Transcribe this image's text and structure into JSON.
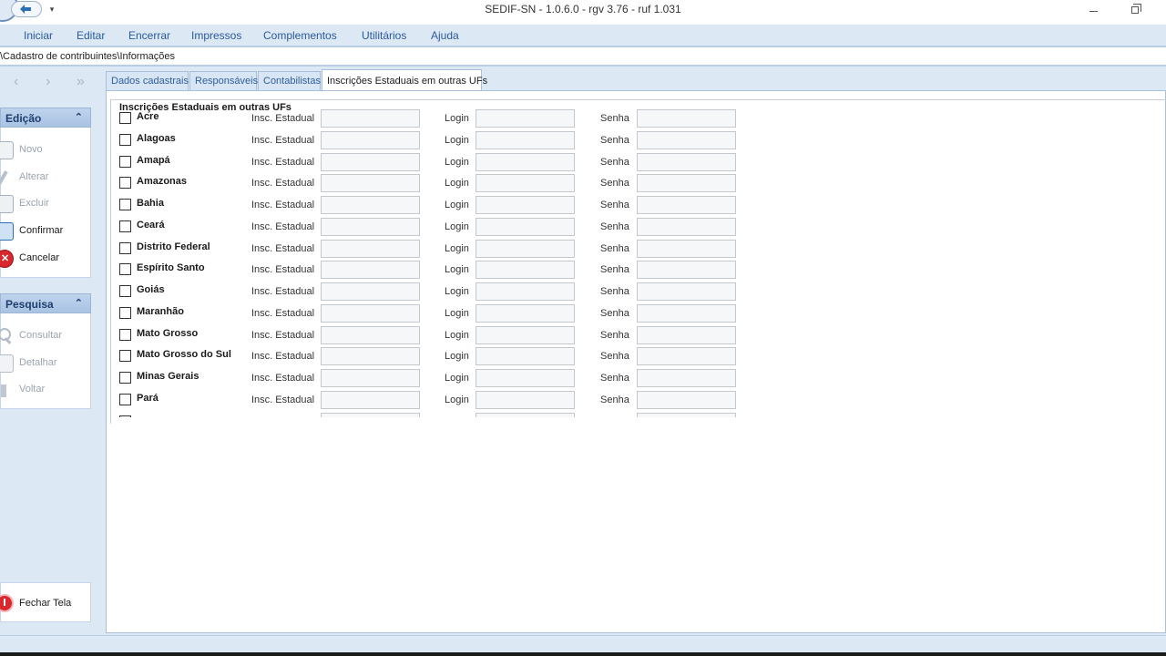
{
  "window": {
    "title": "SEDIF-SN - 1.0.6.0 - rgv 3.76 - ruf 1.031",
    "qat_dropdown": "▾"
  },
  "menu": {
    "items": [
      "Iniciar",
      "Editar",
      "Encerrar",
      "Impressos",
      "Complementos",
      "Utilitários",
      "Ajuda"
    ]
  },
  "breadcrumb": "\\Cadastro de contribuintes\\Informações",
  "sidebar": {
    "nav": {
      "back": "‹",
      "forward": "›",
      "last": "»"
    },
    "edicao": {
      "title": "Edição",
      "chevron": "⌃",
      "actions": [
        {
          "label": "Novo",
          "icon": "document-new-icon",
          "enabled": false
        },
        {
          "label": "Alterar",
          "icon": "pencil-icon",
          "enabled": false
        },
        {
          "label": "Excluir",
          "icon": "document-delete-icon",
          "enabled": false
        },
        {
          "label": "Confirmar",
          "icon": "confirm-icon",
          "enabled": true
        },
        {
          "label": "Cancelar",
          "icon": "cancel-icon",
          "enabled": true
        }
      ]
    },
    "pesquisa": {
      "title": "Pesquisa",
      "chevron": "⌃",
      "actions": [
        {
          "label": "Consultar",
          "icon": "magnifier-icon",
          "enabled": false
        },
        {
          "label": "Detalhar",
          "icon": "detail-icon",
          "enabled": false
        },
        {
          "label": "Voltar",
          "icon": "back-icon",
          "enabled": false
        }
      ]
    },
    "fechar": {
      "label": "Fechar Tela",
      "icon": "power-icon"
    }
  },
  "tabs": [
    {
      "label": "Dados cadastrais",
      "active": false
    },
    {
      "label": "Responsáveis",
      "active": false
    },
    {
      "label": "Contabilistas",
      "active": false
    },
    {
      "label": "Inscrições Estaduais em outras UFs",
      "active": true
    }
  ],
  "group": {
    "title": "Inscrições Estaduais em outras UFs",
    "field_labels": {
      "ie": "Insc. Estadual",
      "login": "Login",
      "senha": "Senha"
    },
    "states": [
      {
        "name": "Acre",
        "checked": false,
        "ie": "",
        "login": "",
        "senha": ""
      },
      {
        "name": "Alagoas",
        "checked": false,
        "ie": "",
        "login": "",
        "senha": ""
      },
      {
        "name": "Amapá",
        "checked": false,
        "ie": "",
        "login": "",
        "senha": ""
      },
      {
        "name": "Amazonas",
        "checked": false,
        "ie": "",
        "login": "",
        "senha": ""
      },
      {
        "name": "Bahia",
        "checked": false,
        "ie": "",
        "login": "",
        "senha": ""
      },
      {
        "name": "Ceará",
        "checked": false,
        "ie": "",
        "login": "",
        "senha": ""
      },
      {
        "name": "Distrito Federal",
        "checked": false,
        "ie": "",
        "login": "",
        "senha": ""
      },
      {
        "name": "Espírito Santo",
        "checked": false,
        "ie": "",
        "login": "",
        "senha": ""
      },
      {
        "name": "Goiás",
        "checked": false,
        "ie": "",
        "login": "",
        "senha": ""
      },
      {
        "name": "Maranhão",
        "checked": false,
        "ie": "",
        "login": "",
        "senha": ""
      },
      {
        "name": "Mato Grosso",
        "checked": false,
        "ie": "",
        "login": "",
        "senha": ""
      },
      {
        "name": "Mato Grosso do Sul",
        "checked": false,
        "ie": "",
        "login": "",
        "senha": ""
      },
      {
        "name": "Minas Gerais",
        "checked": false,
        "ie": "",
        "login": "",
        "senha": ""
      },
      {
        "name": "Pará",
        "checked": false,
        "ie": "",
        "login": "",
        "senha": ""
      },
      {
        "name": "",
        "checked": false,
        "ie": "",
        "login": "",
        "senha": ""
      }
    ]
  },
  "colors": {
    "menu_text": "#2a5a9e",
    "chrome_bg": "#dde8f5",
    "panel_header": "#bfd3ec",
    "cancel_red": "#d9272e"
  }
}
